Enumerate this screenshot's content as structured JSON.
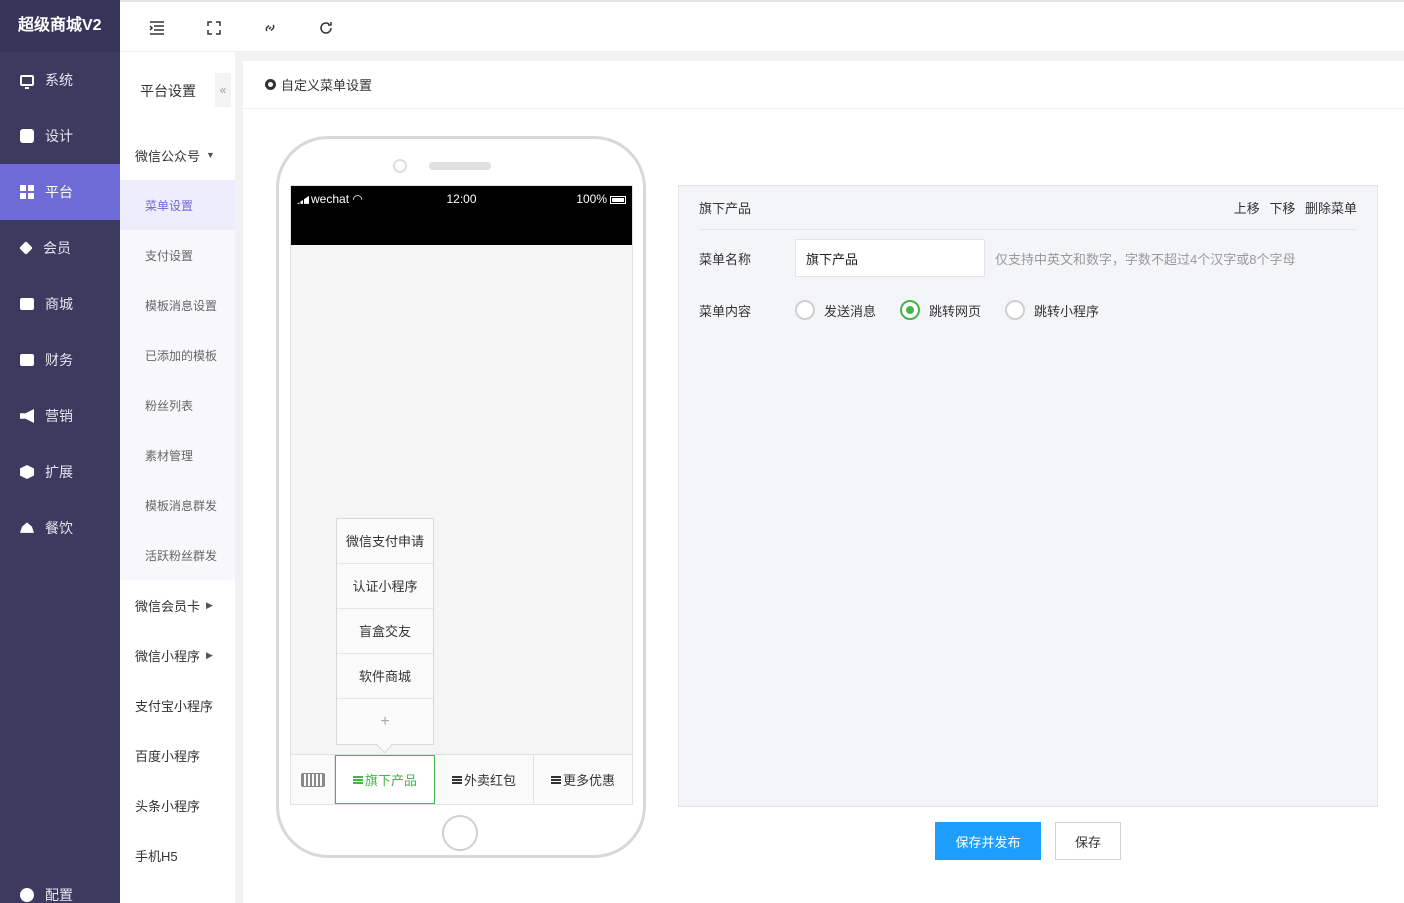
{
  "brand": "超级商城V2",
  "sidebar": {
    "items": [
      {
        "label": "系统",
        "icon": "monitor-icon"
      },
      {
        "label": "设计",
        "icon": "puzzle-icon"
      },
      {
        "label": "平台",
        "icon": "grid-icon",
        "active": true
      },
      {
        "label": "会员",
        "icon": "diamond-icon"
      },
      {
        "label": "商城",
        "icon": "mail-icon"
      },
      {
        "label": "财务",
        "icon": "wallet-icon"
      },
      {
        "label": "营销",
        "icon": "megaphone-icon"
      },
      {
        "label": "扩展",
        "icon": "cube-icon"
      },
      {
        "label": "餐饮",
        "icon": "bell-icon"
      }
    ],
    "bottom": {
      "label": "配置",
      "icon": "cog-icon"
    }
  },
  "subbar": {
    "title": "平台设置",
    "collapse": "«",
    "groups": [
      {
        "label": "微信公众号",
        "caret": "▼"
      },
      {
        "label": "微信会员卡",
        "caret": "▶"
      },
      {
        "label": "微信小程序",
        "caret": "▶"
      },
      {
        "label": "支付宝小程序"
      },
      {
        "label": "百度小程序"
      },
      {
        "label": "头条小程序"
      },
      {
        "label": "手机H5"
      }
    ],
    "items": [
      "菜单设置",
      "支付设置",
      "模板消息设置",
      "已添加的模板",
      "粉丝列表",
      "素材管理",
      "模板消息群发",
      "活跃粉丝群发"
    ]
  },
  "topbar": {
    "icons": [
      "menu-fold-icon",
      "fullscreen-icon",
      "link-icon",
      "refresh-icon"
    ]
  },
  "content": {
    "title": "自定义菜单设置"
  },
  "phone": {
    "status_left": "wechat",
    "status_time": "12:00",
    "status_battery": "100%",
    "submenu": [
      "微信支付申请",
      "认证小程序",
      "盲盒交友",
      "软件商城"
    ],
    "submenu_add": "+",
    "menubar": [
      "旗下产品",
      "外卖红包",
      "更多优惠"
    ]
  },
  "panel": {
    "title": "旗下产品",
    "move_up": "上移",
    "move_down": "下移",
    "delete": "删除菜单",
    "name_label": "菜单名称",
    "name_value": "旗下产品",
    "name_hint": "仅支持中英文和数字，字数不超过4个汉字或8个字母",
    "content_label": "菜单内容",
    "options": [
      "发送消息",
      "跳转网页",
      "跳转小程序"
    ],
    "selected": "跳转网页"
  },
  "buttons": {
    "publish": "保存并发布",
    "save": "保存"
  },
  "colors": {
    "sidebar": "#3d3a5f",
    "active": "#6e6ad6",
    "green": "#44b549",
    "primary": "#1e9fff"
  }
}
